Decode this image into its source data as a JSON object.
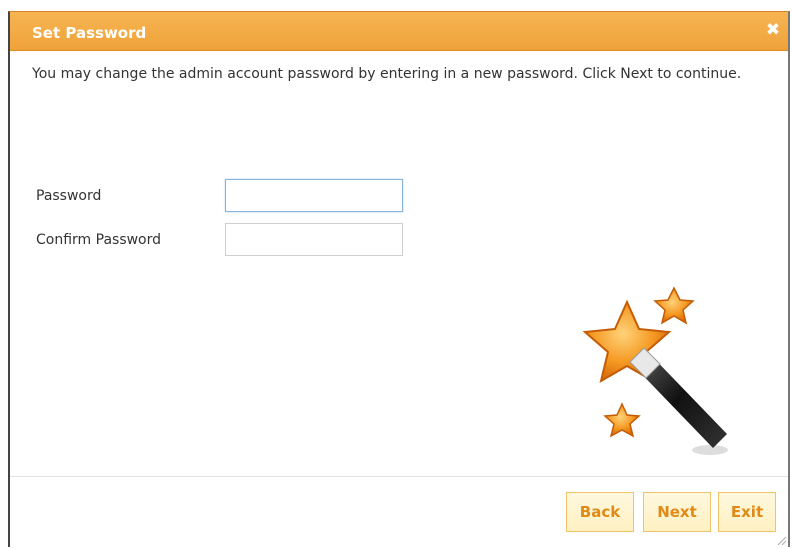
{
  "dialog": {
    "title": "Set Password",
    "close_glyph": "✖",
    "description": "You may change the admin account password by entering in a new password. Click Next to continue."
  },
  "form": {
    "password": {
      "label": "Password",
      "value": ""
    },
    "confirm_password": {
      "label": "Confirm Password",
      "value": ""
    }
  },
  "illustration": {
    "icon": "magic-wand-stars-icon"
  },
  "buttons": {
    "back": "Back",
    "next": "Next",
    "exit": "Exit"
  },
  "colors": {
    "titlebar": "#f0a23a",
    "button_text": "#e08a18",
    "button_border": "#f0c36a",
    "star": "#f08a1e"
  }
}
